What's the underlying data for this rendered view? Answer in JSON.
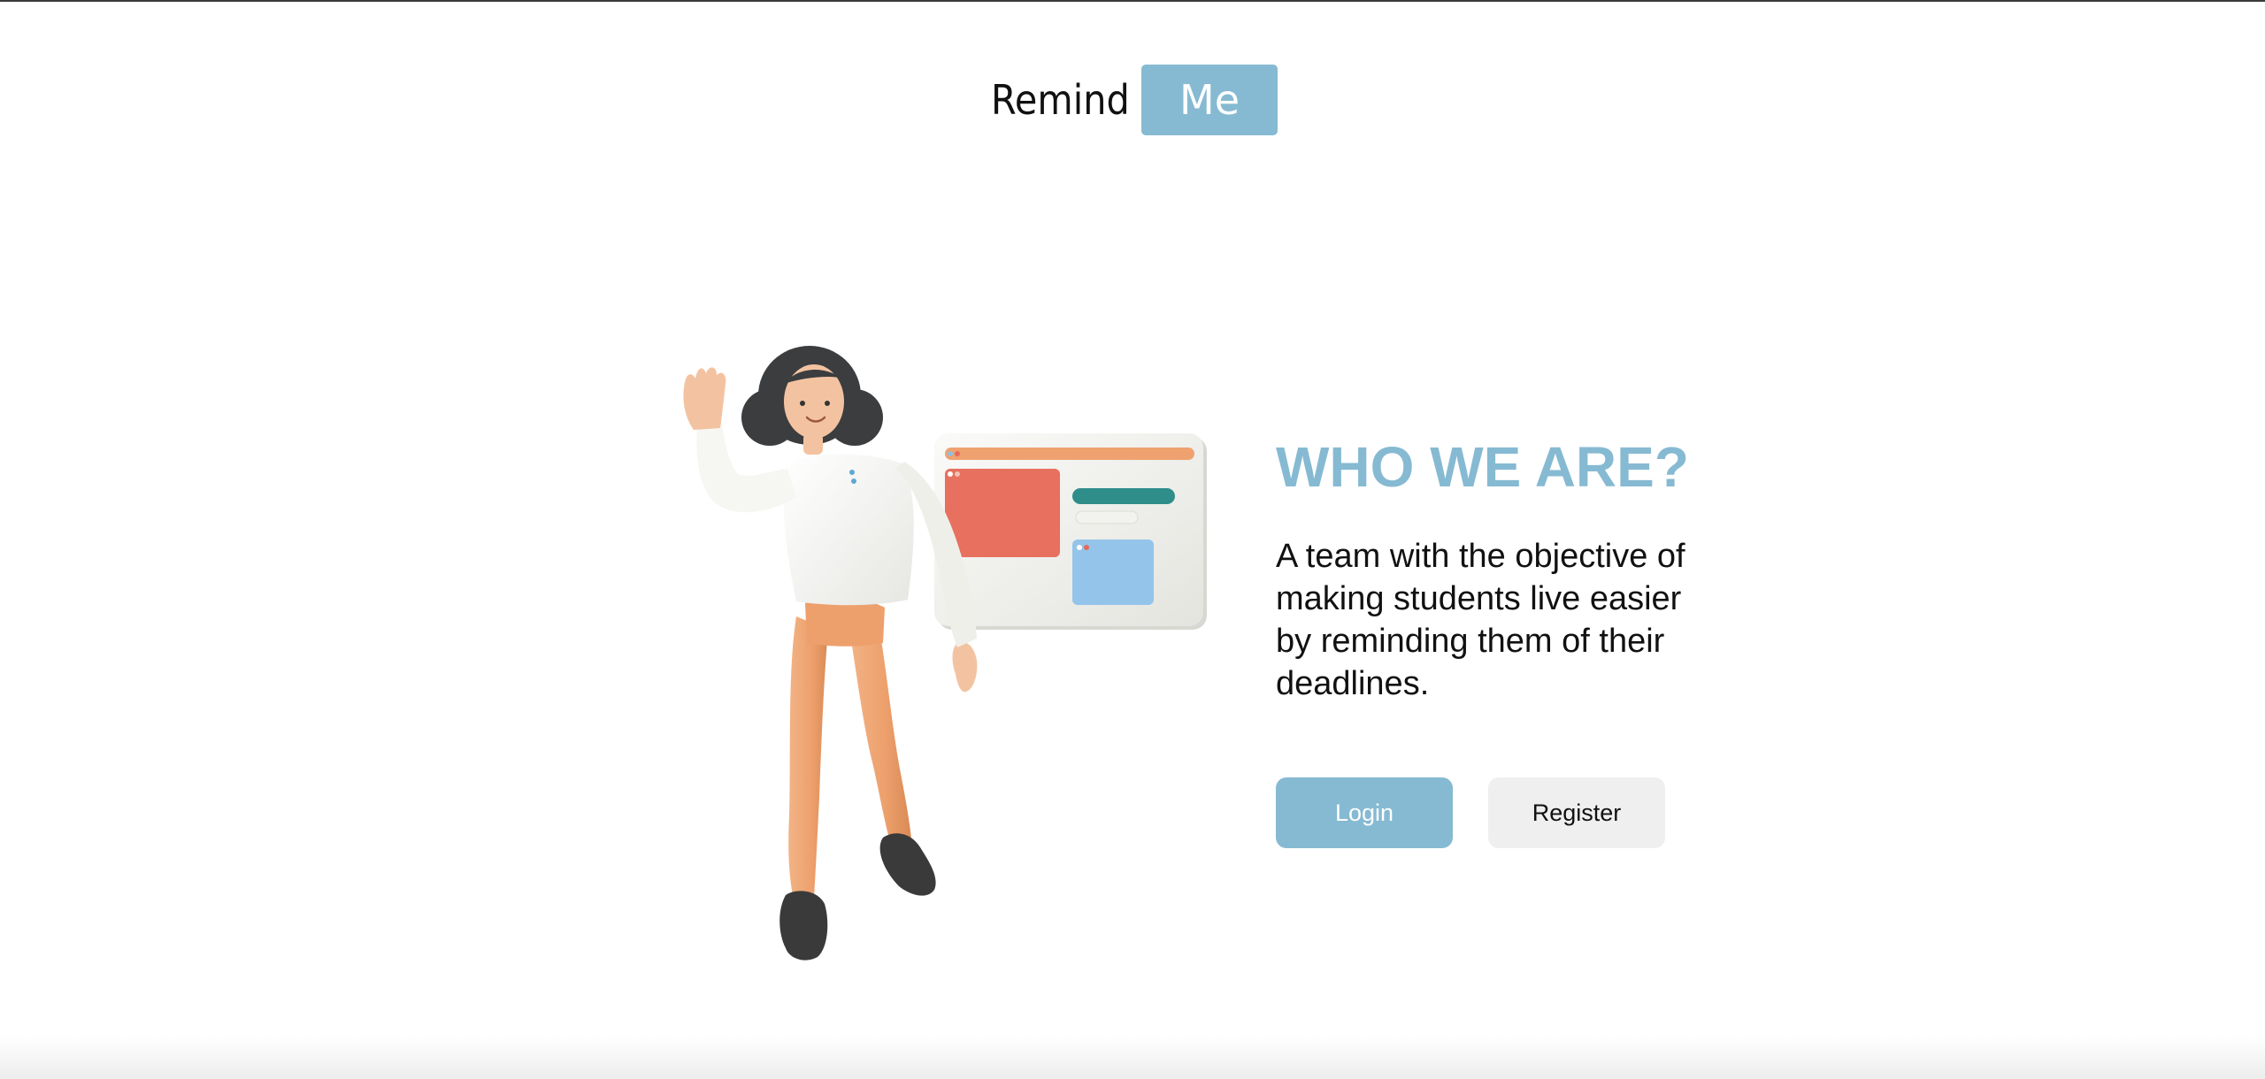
{
  "header": {
    "logo_word1": "Remind",
    "logo_word2": "Me"
  },
  "hero": {
    "illustration": "person-waving-with-dashboard-icon",
    "heading": "WHO WE ARE?",
    "description": "A team with the objective of making students live easier by reminding them of their deadlines.",
    "login_label": "Login",
    "register_label": "Register"
  },
  "colors": {
    "accent": "#86bad2",
    "text": "#111111",
    "secondary_button": "#efefef"
  }
}
